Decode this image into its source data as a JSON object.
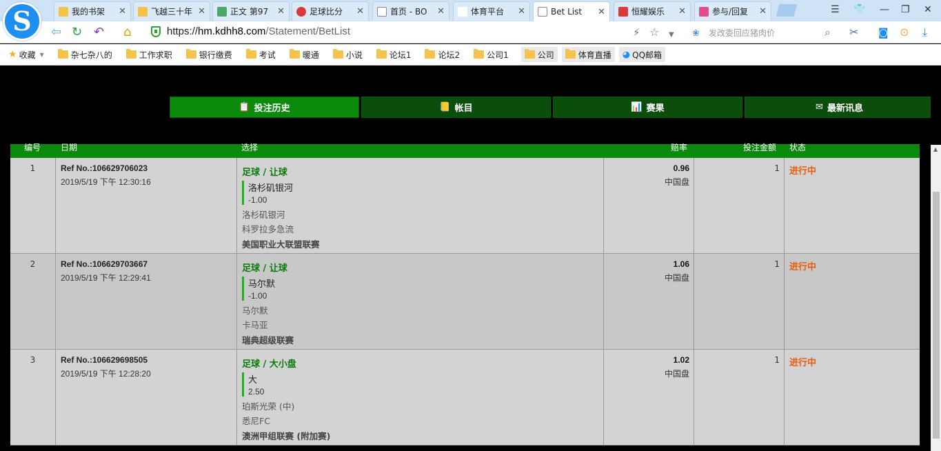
{
  "tabs": [
    {
      "label": "我的书架",
      "icon_color": "#f5c24c",
      "active": false
    },
    {
      "label": "飞越三十年",
      "icon_color": "#f5c24c",
      "active": false
    },
    {
      "label": "正文 第97",
      "icon_color": "#4aa86b",
      "active": false
    },
    {
      "label": "足球比分",
      "icon_color": "#d93a3a",
      "active": false
    },
    {
      "label": "首页 - BO",
      "icon_color": "#ffffff",
      "active": false
    },
    {
      "label": "体育平台",
      "icon_color": "#ffffff",
      "active": false
    },
    {
      "label": "Bet List",
      "icon_color": "#ffffff",
      "active": true
    },
    {
      "label": "恒耀娱乐",
      "icon_color": "#d93a3a",
      "active": false
    },
    {
      "label": "参与/回复",
      "icon_color": "#e04f8a",
      "active": false
    }
  ],
  "address": {
    "scheme": "https://",
    "domain": "hm.kdhh8.com",
    "path": "/Statement/BetList",
    "search_placeholder": "发改委回应猪肉价"
  },
  "bookmarks": {
    "favorites": "收藏",
    "items": [
      "杂七杂八的",
      "工作求职",
      "银行缴费",
      "考试",
      "暖通",
      "小说",
      "论坛1",
      "论坛2",
      "公司1",
      "公司",
      "体育直播",
      "QQ邮箱"
    ]
  },
  "menu": [
    {
      "label": "投注历史",
      "icon": "📋",
      "bg": "#0c8a0c"
    },
    {
      "label": "帐目",
      "icon": "📒",
      "bg": "#0b4d0b"
    },
    {
      "label": "赛果",
      "icon": "📊",
      "bg": "#0b4d0b"
    },
    {
      "label": "最新讯息",
      "icon": "✉",
      "bg": "#0b4d0b"
    }
  ],
  "table": {
    "headers": [
      "编号",
      "日期",
      "选择",
      "赔率",
      "投注金额",
      "状态"
    ],
    "rows": [
      {
        "no": "1",
        "ref": "Ref No.:106629706023",
        "date": "2019/5/19 下午 12:30:16",
        "sport": "足球 / 让球",
        "pick": "洛杉矶银河",
        "line": "-1.00",
        "home": "洛杉矶银河",
        "away": "科罗拉多急流",
        "league": "美国职业大联盟联赛",
        "odds": "0.96",
        "odds_type": "中国盘",
        "stake": "1",
        "status": "进行中"
      },
      {
        "no": "2",
        "ref": "Ref No.:106629703667",
        "date": "2019/5/19 下午 12:29:41",
        "sport": "足球 / 让球",
        "pick": "马尔默",
        "line": "-1.00",
        "home": "马尔默",
        "away": "卡马亚",
        "league": "瑞典超级联赛",
        "odds": "1.06",
        "odds_type": "中国盘",
        "stake": "1",
        "status": "进行中"
      },
      {
        "no": "3",
        "ref": "Ref No.:106629698505",
        "date": "2019/5/19 下午 12:28:20",
        "sport": "足球 / 大小盘",
        "pick": "大",
        "line": "2.50",
        "home": "珀斯光荣 (中)",
        "away": "悉尼FC",
        "league": "澳洲甲组联赛 (附加赛)",
        "odds": "1.02",
        "odds_type": "中国盘",
        "stake": "1",
        "status": "进行中"
      }
    ]
  }
}
